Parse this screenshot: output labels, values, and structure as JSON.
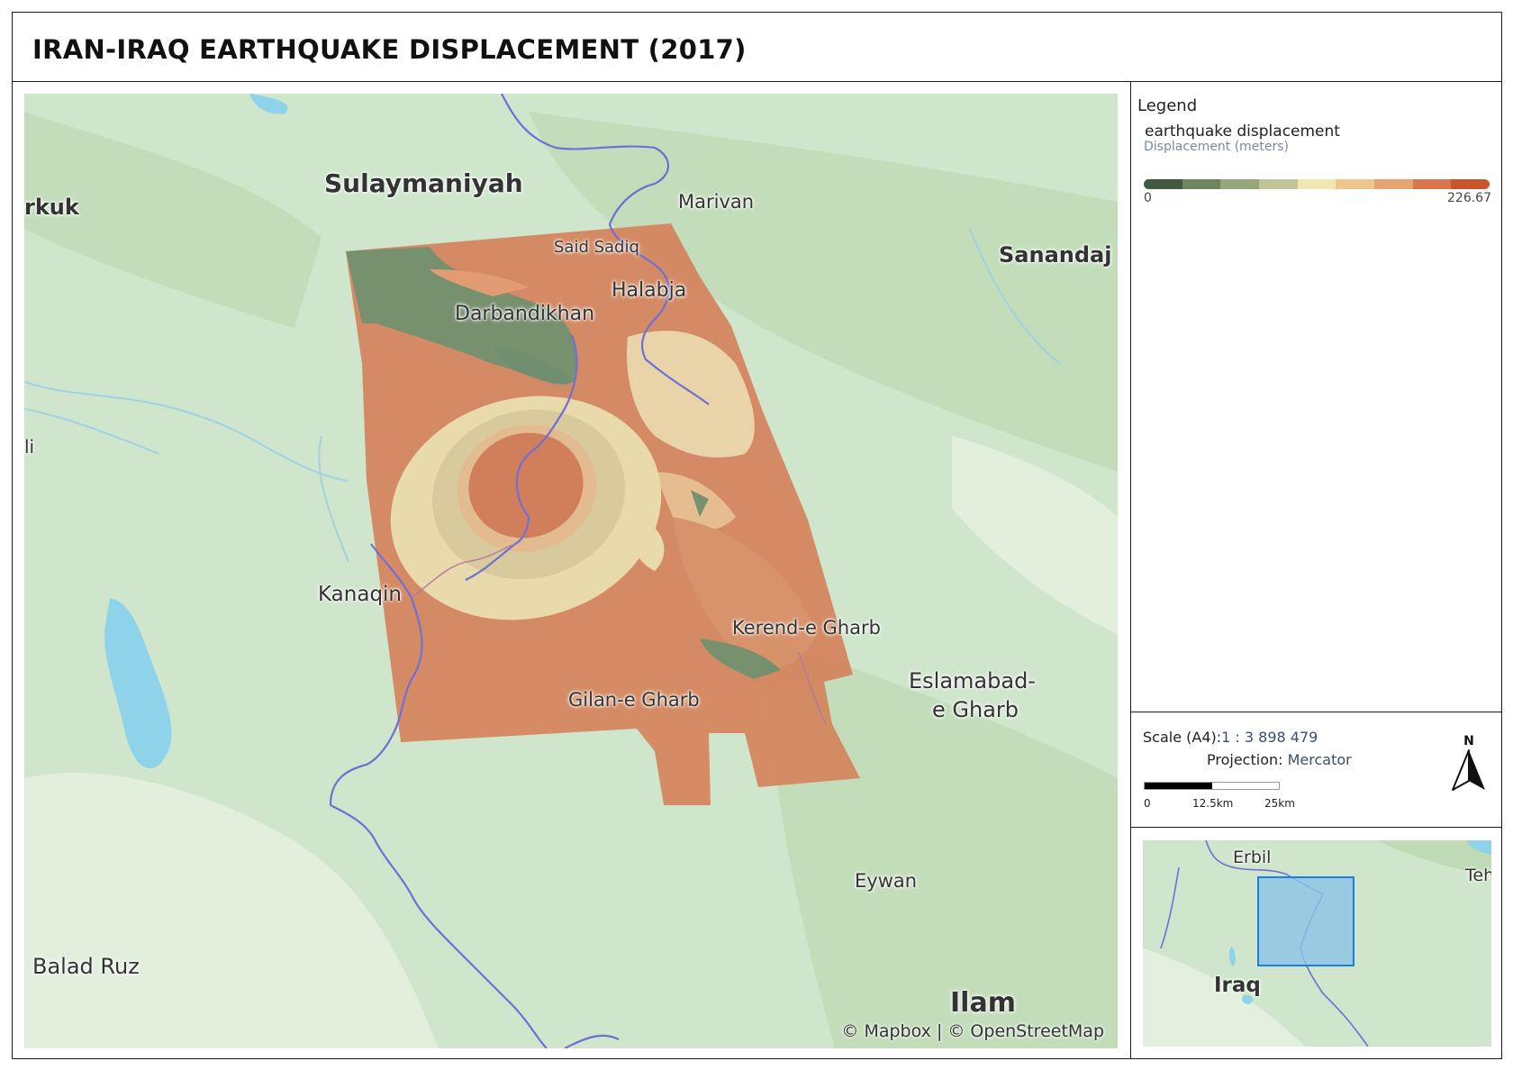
{
  "title": "IRAN-IRAQ EARTHQUAKE DISPLACEMENT (2017)",
  "map": {
    "labels": {
      "sulaymaniyah": "Sulaymaniyah",
      "kirkuk": "rkuk",
      "marivan": "Marivan",
      "sanandaj": "Sanandaj",
      "said_sadiq": "Said Sadiq",
      "halabja": "Halabja",
      "darbandikhan": "Darbandikhan",
      "li": "li",
      "kanaqin": "Kanaqin",
      "kerend": "Kerend-e Gharb",
      "eslamabad_1": "Eslamabad-",
      "eslamabad_2": "e Gharb",
      "gilan": "Gilan-e Gharb",
      "eywan": "Eywan",
      "balad_ruz": "Balad Ruz",
      "ilam": "Ilam"
    },
    "attribution": "© Mapbox | © OpenStreetMap",
    "colors": {
      "land": "#cfe6cc",
      "water": "#8fd3ea",
      "border": "#6f6fd6",
      "displacement_base": "#d5825a"
    }
  },
  "legend": {
    "title": "Legend",
    "layer": "earthquake displacement",
    "subtitle": "Displacement (meters)",
    "min": "0",
    "max": "226.67",
    "ramp": [
      "#3f5a3e",
      "#6d8660",
      "#96a67c",
      "#c1c496",
      "#f2e6b2",
      "#efc58f",
      "#e5a373",
      "#d9764f",
      "#c8552e"
    ]
  },
  "scale": {
    "label": "Scale (A4):",
    "value": "1 : 3 898 479",
    "projection_label": "Projection:",
    "projection_value": "Mercator",
    "ticks": [
      "0",
      "12.5km",
      "25km"
    ]
  },
  "north_label": "N",
  "inset": {
    "labels": {
      "erbil": "Erbil",
      "teh": "Teh",
      "iraq": "Iraq"
    },
    "colors": {
      "extent_fill": "#8cc3e6",
      "extent_stroke": "#1a7fe0"
    }
  }
}
